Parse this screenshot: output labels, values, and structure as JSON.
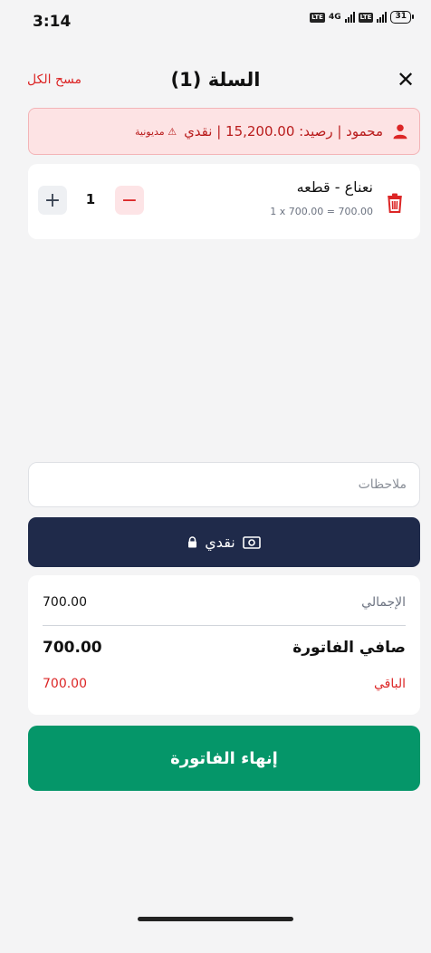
{
  "status_bar": {
    "time": "3:14",
    "network": "4G",
    "battery": "31",
    "lte_badge": "LTE"
  },
  "header": {
    "title": "السلة (1)",
    "clear_all": "مسح الكل",
    "close_icon": "close-icon"
  },
  "customer": {
    "info": "محمود | رصيد: 15,200.00 | نقدي",
    "debt_label": "⚠ مديونية",
    "icon": "person-icon"
  },
  "cart": {
    "items": [
      {
        "name": "نعناع - قطعه",
        "calc": "1 x 700.00 = 700.00",
        "quantity": "1"
      }
    ]
  },
  "notes": {
    "placeholder": "ملاحظات"
  },
  "payment": {
    "label": "نقدي",
    "icons": [
      "money-icon",
      "lock-icon"
    ]
  },
  "totals": {
    "total_label": "الإجمالي",
    "total_value": "700.00",
    "net_label": "صافي الفاتورة",
    "net_value": "700.00",
    "remaining_label": "الباقي",
    "remaining_value": "700.00"
  },
  "finish_button": "إنهاء الفاتورة",
  "colors": {
    "danger": "#dc2626",
    "navy": "#1f2a4a",
    "green": "#059669",
    "banner_bg": "#fde3e4"
  }
}
